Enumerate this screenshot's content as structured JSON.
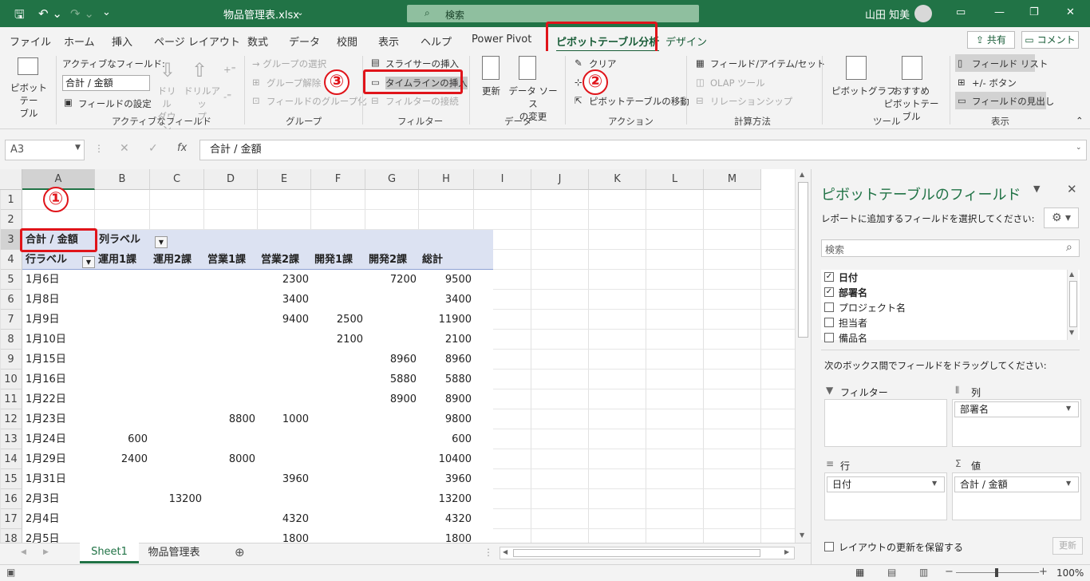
{
  "title": {
    "filename": "物品管理表.xlsx",
    "search": "検索",
    "user": "山田 知美"
  },
  "tabs": [
    "ファイル",
    "ホーム",
    "挿入",
    "ページ レイアウト",
    "数式",
    "データ",
    "校閲",
    "表示",
    "ヘルプ",
    "Power Pivot",
    "ピボットテーブル分析",
    "デザイン"
  ],
  "share": "共有",
  "comment": "コメント",
  "ribbon": {
    "pivottable": "ピボットテー\nブル",
    "active_field_label": "アクティブなフィールド:",
    "active_field_value": "合計 / 金額",
    "field_settings": "フィールドの設定",
    "drill_down": "ドリル\nダウン",
    "drill_up": "ドリルアッ\nプ",
    "group_active": "アクティブなフィールド",
    "group_select": "→ グループの選択",
    "group_ungroup": "グループ解除",
    "group_field": "フィールドのグループ化",
    "group_group": "グループ",
    "slicer": "スライサーの挿入",
    "timeline": "タイムラインの挿入",
    "filter_conn": "フィルターの接続",
    "group_filter": "フィルター",
    "refresh": "更新",
    "change_source": "データ ソース\nの変更",
    "group_data": "データ",
    "clear": "クリア",
    "select": "選択",
    "move": "ピボットテーブルの移動",
    "group_action": "アクション",
    "fields_items": "フィールド/アイテム/セット",
    "olap": "OLAP ツール",
    "relations": "リレーションシップ",
    "group_calc": "計算方法",
    "pivotchart": "ピボットグラフ",
    "recommended": "おすすめ\nピボットテーブル",
    "group_tools": "ツール",
    "field_list": "フィールド リスト",
    "buttons": "+/- ボタン",
    "headers": "フィールドの見出し",
    "group_show": "表示"
  },
  "formula": {
    "namebox": "A3",
    "content": "合計 / 金額"
  },
  "callouts": [
    "①",
    "②",
    "③"
  ],
  "columns": [
    "A",
    "B",
    "C",
    "D",
    "E",
    "F",
    "G",
    "H",
    "I",
    "J",
    "K",
    "L",
    "M"
  ],
  "rows": [
    "1",
    "2",
    "3",
    "4",
    "5",
    "6",
    "7",
    "8",
    "9",
    "10",
    "11",
    "12",
    "13",
    "14",
    "15",
    "16",
    "17",
    "18"
  ],
  "pivot": {
    "corner": "合計 / 金額",
    "col_label": "列ラベル",
    "row_label": "行ラベル",
    "headers": [
      "運用1課",
      "運用2課",
      "営業1課",
      "営業2課",
      "開発1課",
      "開発2課",
      "総計"
    ],
    "data": [
      [
        "1月6日",
        "",
        "",
        "",
        "2300",
        "",
        "7200",
        "9500"
      ],
      [
        "1月8日",
        "",
        "",
        "",
        "3400",
        "",
        "",
        "3400"
      ],
      [
        "1月9日",
        "",
        "",
        "",
        "9400",
        "2500",
        "",
        "11900"
      ],
      [
        "1月10日",
        "",
        "",
        "",
        "",
        "2100",
        "",
        "2100"
      ],
      [
        "1月15日",
        "",
        "",
        "",
        "",
        "",
        "8960",
        "8960"
      ],
      [
        "1月16日",
        "",
        "",
        "",
        "",
        "",
        "5880",
        "5880"
      ],
      [
        "1月22日",
        "",
        "",
        "",
        "",
        "",
        "8900",
        "8900"
      ],
      [
        "1月23日",
        "",
        "",
        "8800",
        "1000",
        "",
        "",
        "9800"
      ],
      [
        "1月24日",
        "600",
        "",
        "",
        "",
        "",
        "",
        "600"
      ],
      [
        "1月29日",
        "2400",
        "",
        "8000",
        "",
        "",
        "",
        "10400"
      ],
      [
        "1月31日",
        "",
        "",
        "",
        "3960",
        "",
        "",
        "3960"
      ],
      [
        "2月3日",
        "",
        "13200",
        "",
        "",
        "",
        "",
        "13200"
      ],
      [
        "2月4日",
        "",
        "",
        "",
        "4320",
        "",
        "",
        "4320"
      ],
      [
        "2月5日",
        "",
        "",
        "",
        "1800",
        "",
        "",
        "1800"
      ]
    ]
  },
  "panel": {
    "title": "ピボットテーブルのフィールド",
    "subtitle": "レポートに追加するフィールドを選択してください:",
    "search": "検索",
    "fields": [
      {
        "name": "日付",
        "checked": true
      },
      {
        "name": "部署名",
        "checked": true
      },
      {
        "name": "プロジェクト名",
        "checked": false
      },
      {
        "name": "担当者",
        "checked": false
      },
      {
        "name": "備品名",
        "checked": false
      }
    ],
    "drag_hint": "次のボックス間でフィールドをドラッグしてください:",
    "filter": "フィルター",
    "columns": "列",
    "rows": "行",
    "values": "値",
    "col_item": "部署名",
    "row_item": "日付",
    "val_item": "合計 / 金額",
    "defer": "レイアウトの更新を保留する",
    "update": "更新"
  },
  "sheets": [
    "Sheet1",
    "物品管理表"
  ],
  "zoom": "100%"
}
